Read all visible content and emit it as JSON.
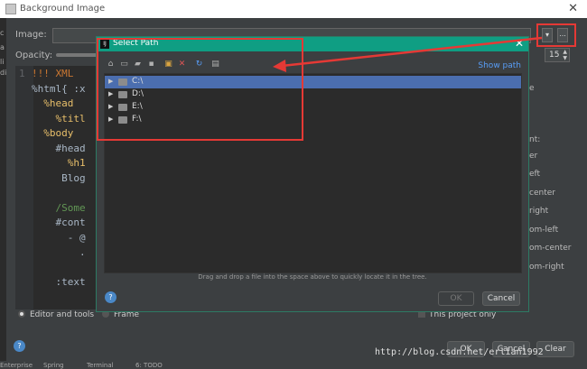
{
  "outer_window": {
    "title": "Background Image",
    "close_glyph": "✕",
    "left_strip_letters": [
      "c",
      "a",
      "li",
      "di"
    ]
  },
  "image_row": {
    "label": "Image:",
    "value": "",
    "dropdown_glyph": "▾",
    "ellipsis_glyph": "..."
  },
  "opacity_row": {
    "label": "Opacity:",
    "value": "15"
  },
  "editor": {
    "lines": [
      {
        "num": "1",
        "text": "!!! XML"
      },
      {
        "num": "",
        "text": "%html{ :x"
      },
      {
        "num": "",
        "text": "  %head"
      },
      {
        "num": "",
        "text": "    %titl"
      },
      {
        "num": "",
        "text": "  %body"
      },
      {
        "num": "",
        "text": "    #head"
      },
      {
        "num": "",
        "text": "      %h1"
      },
      {
        "num": "",
        "text": "     Blog"
      },
      {
        "num": "",
        "text": ""
      },
      {
        "num": "",
        "text": "    /Some"
      },
      {
        "num": "",
        "text": "    #cont"
      },
      {
        "num": "",
        "text": "      - @"
      },
      {
        "num": "",
        "text": "        ."
      },
      {
        "num": "",
        "text": ""
      },
      {
        "num": "",
        "text": "    :text"
      }
    ]
  },
  "right_labels": [
    "e",
    "nt:",
    "er",
    "eft",
    "center",
    "right",
    "om-left",
    "om-center",
    "om-right"
  ],
  "bottom": {
    "radio_editor_label": "Editor and tools",
    "radio_frame_label": "Frame",
    "project_label": "This project only",
    "help_glyph": "?",
    "ok_label": "OK",
    "cancel_label": "Cancel",
    "clear_label": "Clear",
    "watermark": "http://blog.csdn.net/erlian1992",
    "status_items": [
      "Enterprise",
      "Spring",
      "Terminal",
      "6: TODO"
    ]
  },
  "select_path": {
    "title": "Select Path",
    "app_icon_text": "IJ",
    "close_glyph": "✕",
    "show_path_label": "Show path",
    "toolbar_icons": [
      "home-icon",
      "desktop-icon",
      "project-icon",
      "module-icon",
      "new-folder-icon",
      "delete-icon",
      "refresh-icon",
      "show-hidden-icon"
    ],
    "drives": [
      {
        "label": "C:\\",
        "selected": true
      },
      {
        "label": "D:\\",
        "selected": false
      },
      {
        "label": "E:\\",
        "selected": false
      },
      {
        "label": "F:\\",
        "selected": false
      }
    ],
    "drag_hint": "Drag and drop a file into the space above to quickly locate it in the tree.",
    "help_glyph": "?",
    "ok_label": "OK",
    "cancel_label": "Cancel"
  },
  "colors": {
    "dialog_title_bar": "#0f9e83",
    "selection": "#4b6eaf",
    "annotation_red": "#e53935",
    "link": "#589df6"
  }
}
